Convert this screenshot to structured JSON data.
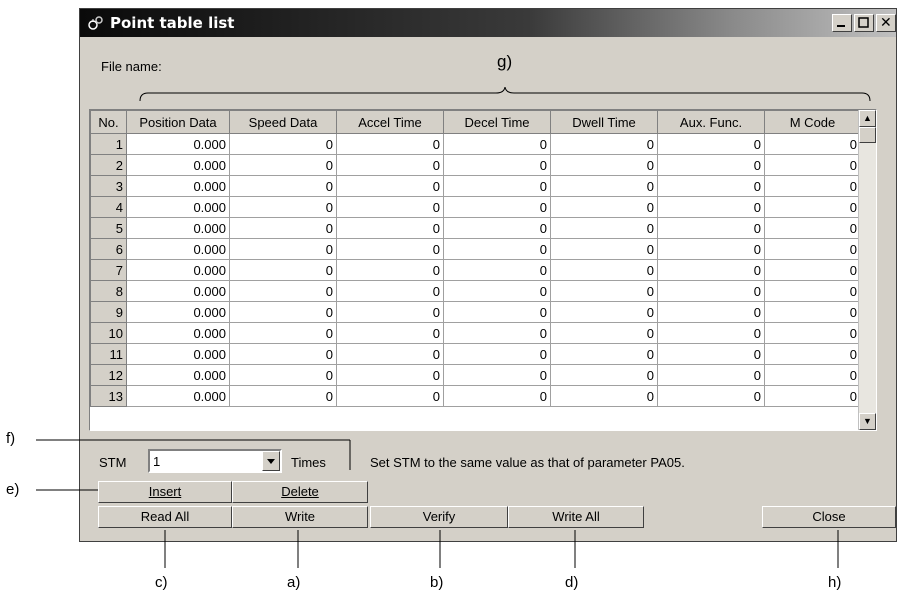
{
  "window": {
    "title": "Point table list",
    "close_glyph": "✕"
  },
  "file_label": "File name:",
  "table": {
    "headers": [
      "No.",
      "Position Data",
      "Speed Data",
      "Accel Time",
      "Decel Time",
      "Dwell Time",
      "Aux. Func.",
      "M Code"
    ],
    "rows": [
      [
        "1",
        "0.000",
        "0",
        "0",
        "0",
        "0",
        "0",
        "0"
      ],
      [
        "2",
        "0.000",
        "0",
        "0",
        "0",
        "0",
        "0",
        "0"
      ],
      [
        "3",
        "0.000",
        "0",
        "0",
        "0",
        "0",
        "0",
        "0"
      ],
      [
        "4",
        "0.000",
        "0",
        "0",
        "0",
        "0",
        "0",
        "0"
      ],
      [
        "5",
        "0.000",
        "0",
        "0",
        "0",
        "0",
        "0",
        "0"
      ],
      [
        "6",
        "0.000",
        "0",
        "0",
        "0",
        "0",
        "0",
        "0"
      ],
      [
        "7",
        "0.000",
        "0",
        "0",
        "0",
        "0",
        "0",
        "0"
      ],
      [
        "8",
        "0.000",
        "0",
        "0",
        "0",
        "0",
        "0",
        "0"
      ],
      [
        "9",
        "0.000",
        "0",
        "0",
        "0",
        "0",
        "0",
        "0"
      ],
      [
        "10",
        "0.000",
        "0",
        "0",
        "0",
        "0",
        "0",
        "0"
      ],
      [
        "11",
        "0.000",
        "0",
        "0",
        "0",
        "0",
        "0",
        "0"
      ],
      [
        "12",
        "0.000",
        "0",
        "0",
        "0",
        "0",
        "0",
        "0"
      ],
      [
        "13",
        "0.000",
        "0",
        "0",
        "0",
        "0",
        "0",
        "0"
      ]
    ]
  },
  "stm": {
    "label": "STM",
    "value": "1",
    "unit": "Times",
    "note": "Set STM to the same value as that of parameter PA05."
  },
  "buttons": {
    "insert": "Insert",
    "delete": "Delete",
    "read_all": "Read All",
    "write": "Write",
    "verify": "Verify",
    "write_all": "Write All",
    "close": "Close"
  },
  "annotations": {
    "a": "a)",
    "b": "b)",
    "c": "c)",
    "d": "d)",
    "e": "e)",
    "f": "f)",
    "g": "g)",
    "h": "h)"
  }
}
